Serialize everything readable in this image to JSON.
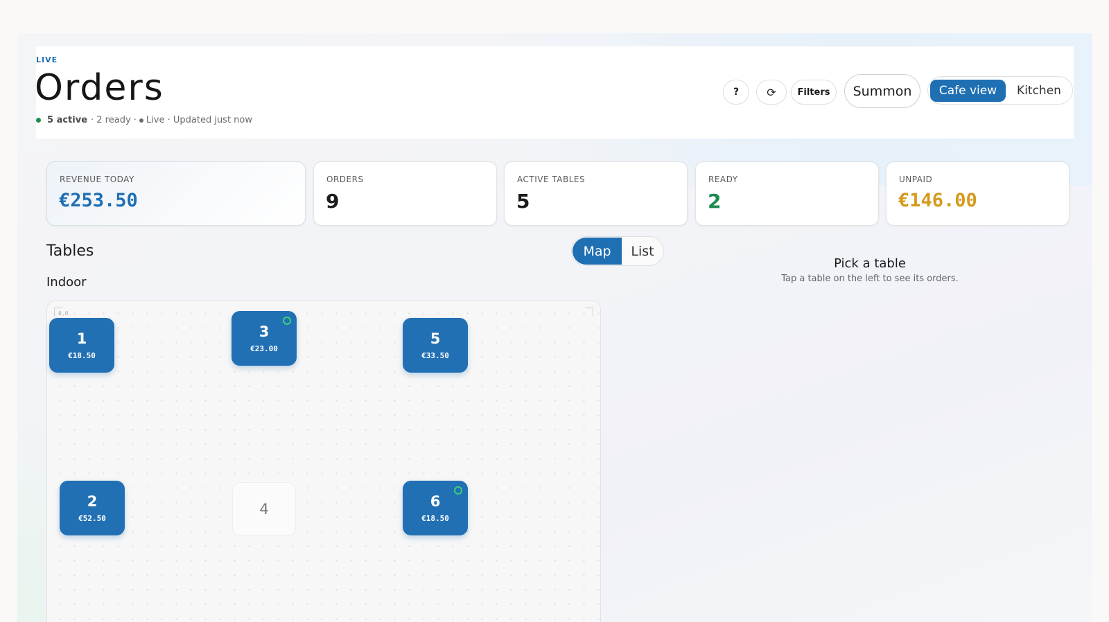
{
  "header": {
    "live_tag": "LIVE",
    "title": "Orders",
    "status": {
      "active": "5 active",
      "ready": "· 2 ready ·",
      "live_updated": "Live · Updated just now"
    },
    "buttons": {
      "help": "?",
      "refresh": "⟳",
      "filters": "Filters",
      "summon": "Summon"
    },
    "view_toggle": {
      "cafe": "Cafe view",
      "kitchen": "Kitchen"
    }
  },
  "kpis": [
    {
      "label": "REVENUE TODAY",
      "value": "€253.50",
      "color": "#1f6fb3"
    },
    {
      "label": "ORDERS",
      "value": "9",
      "color": "#1c1c1c"
    },
    {
      "label": "ACTIVE TABLES",
      "value": "5",
      "color": "#1c1c1c"
    },
    {
      "label": "READY",
      "value": "2",
      "color": "#1a8c4e"
    },
    {
      "label": "UNPAID",
      "value": "€146.00",
      "color": "#d49a1c"
    }
  ],
  "tables_section": {
    "title": "Tables",
    "toggle": {
      "map": "Map",
      "list": "List"
    },
    "area": "Indoor",
    "corner_label": "0,0",
    "tables": [
      {
        "num": "1",
        "amount": "€18.50",
        "active": true,
        "ready": false
      },
      {
        "num": "3",
        "amount": "€23.00",
        "active": true,
        "ready": true
      },
      {
        "num": "5",
        "amount": "€33.50",
        "active": true,
        "ready": false
      },
      {
        "num": "2",
        "amount": "€52.50",
        "active": true,
        "ready": false
      },
      {
        "num": "4",
        "amount": "",
        "active": false,
        "ready": false
      },
      {
        "num": "6",
        "amount": "€18.50",
        "active": true,
        "ready": true
      }
    ]
  },
  "detail": {
    "title": "Pick a table",
    "subtitle": "Tap a table on the left to see its orders."
  }
}
